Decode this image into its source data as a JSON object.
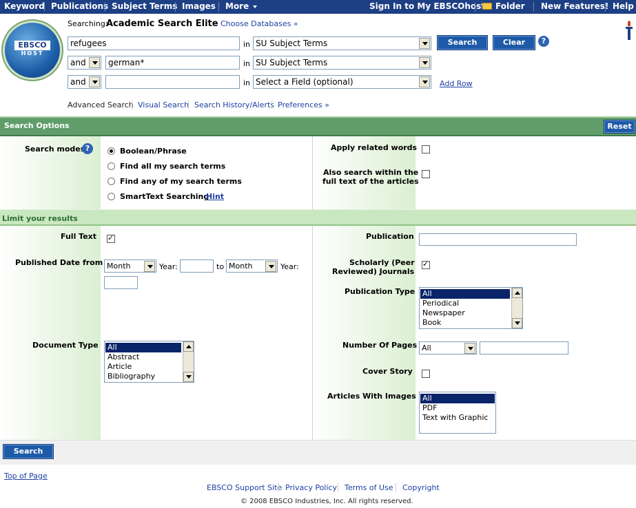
{
  "topnav": {
    "keyword": "Keyword",
    "publications": "Publications",
    "subject_terms": "Subject Terms",
    "images": "Images",
    "more": "More",
    "sign_in": "Sign In to My EBSCOhost",
    "folder": "Folder",
    "new_features": "New Features!",
    "help": "Help"
  },
  "logo": {
    "line1": "EBSCO",
    "line2": "HOST"
  },
  "search": {
    "searching_label": "Searching:",
    "database": "Academic Search Elite",
    "choose_databases": "Choose Databases »",
    "rows": [
      {
        "operator": "",
        "term": "refugees",
        "in": "in",
        "field": "SU Subject Terms"
      },
      {
        "operator": "and",
        "term": "german*",
        "in": "in",
        "field": "SU Subject Terms"
      },
      {
        "operator": "and",
        "term": "",
        "in": "in",
        "field": "Select a Field (optional)"
      }
    ],
    "search_button": "Search",
    "clear_button": "Clear",
    "add_row": "Add Row",
    "help_glyph": "?"
  },
  "subnav": {
    "advanced": "Advanced Search",
    "visual": "Visual Search",
    "history": "Search History/Alerts",
    "preferences": "Preferences »"
  },
  "options": {
    "title": "Search Options",
    "reset": "Reset",
    "search_modes_label": "Search modes",
    "modes": [
      "Boolean/Phrase",
      "Find all my search terms",
      "Find any of my search terms",
      "SmartText Searching"
    ],
    "hint": "Hint",
    "apply_related": "Apply related words",
    "also_search_1": "Also search within the",
    "also_search_2": "full text of the articles"
  },
  "limits": {
    "title": "Limit your results",
    "full_text": "Full Text",
    "published_date": "Published Date from",
    "month": "Month",
    "year": "Year:",
    "to": "to",
    "document_type": "Document Type",
    "document_types": [
      "All",
      "Abstract",
      "Article",
      "Bibliography"
    ],
    "publication": "Publication",
    "scholarly_1": "Scholarly (Peer",
    "scholarly_2": "Reviewed) Journals",
    "publication_type": "Publication Type",
    "publication_types": [
      "All",
      "Periodical",
      "Newspaper",
      "Book"
    ],
    "number_of_pages": "Number Of Pages",
    "pages_select": "All",
    "cover_story": "Cover Story",
    "articles_with_images": "Articles With Images",
    "image_types": [
      "All",
      "PDF",
      "Text with Graphic"
    ]
  },
  "bottom": {
    "search_button": "Search",
    "top_of_page": "Top of Page",
    "support": "EBSCO Support Site",
    "privacy": "Privacy Policy",
    "terms": "Terms of Use",
    "copyright": "Copyright",
    "copyright_line": "© 2008 EBSCO Industries, Inc. All rights reserved."
  },
  "colors": {
    "nav_bg": "#1d3f84",
    "green_bar": "#5f9d6a",
    "light_bar": "#c9e7c0",
    "button": "#1d5aa8",
    "link": "#1d3fa4"
  }
}
